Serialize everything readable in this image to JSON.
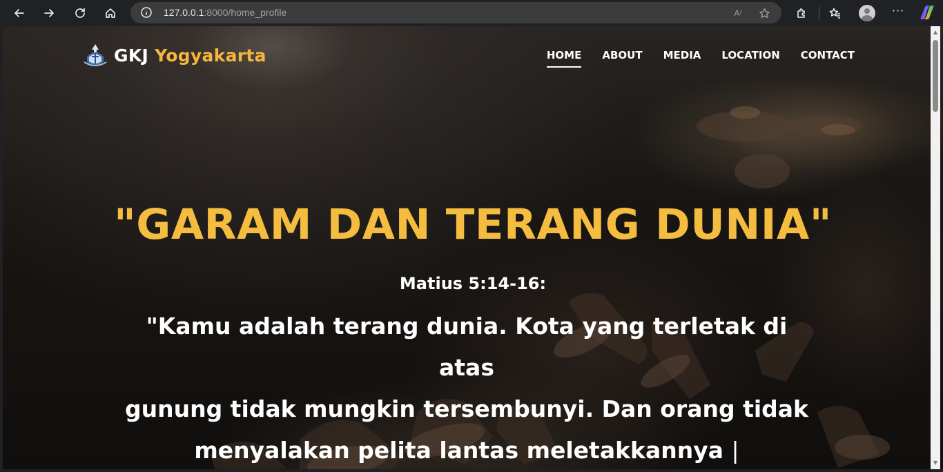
{
  "browser": {
    "url_host": "127.0.0.1",
    "url_rest": ":8000/home_profile",
    "read_aloud_label": "A⁾"
  },
  "site": {
    "brand_main": "GKJ",
    "brand_accent": "Yogyakarta",
    "nav": {
      "home": "HOME",
      "about": "ABOUT",
      "media": "MEDIA",
      "location": "LOCATION",
      "contact": "CONTACT"
    },
    "active_nav": "home"
  },
  "hero": {
    "title": "\"GARAM DAN TERANG DUNIA\"",
    "reference": "Matius 5:14-16:",
    "verse_line1": "\"Kamu adalah terang dunia. Kota yang terletak di atas",
    "verse_line2": "gunung tidak mungkin tersembunyi. Dan orang tidak",
    "verse_line3": "menyalakan pelita lantas meletakkannya",
    "cursor": "|"
  },
  "colors": {
    "accent": "#f5bd3f",
    "brand_accent": "#f5b63a",
    "text": "#ffffff",
    "browser_bg": "#202124",
    "address_bg": "#3c3c3c"
  },
  "icons": {
    "back": "back-arrow-icon",
    "forward": "forward-arrow-icon",
    "refresh": "refresh-icon",
    "home": "home-icon",
    "site_info": "info-icon",
    "read_aloud": "read-aloud-icon",
    "favorite": "star-icon",
    "extensions": "puzzle-icon",
    "favorites": "favorites-icon",
    "profile": "profile-icon",
    "more": "more-icon",
    "copilot": "copilot-icon",
    "logo": "church-logo-icon"
  }
}
